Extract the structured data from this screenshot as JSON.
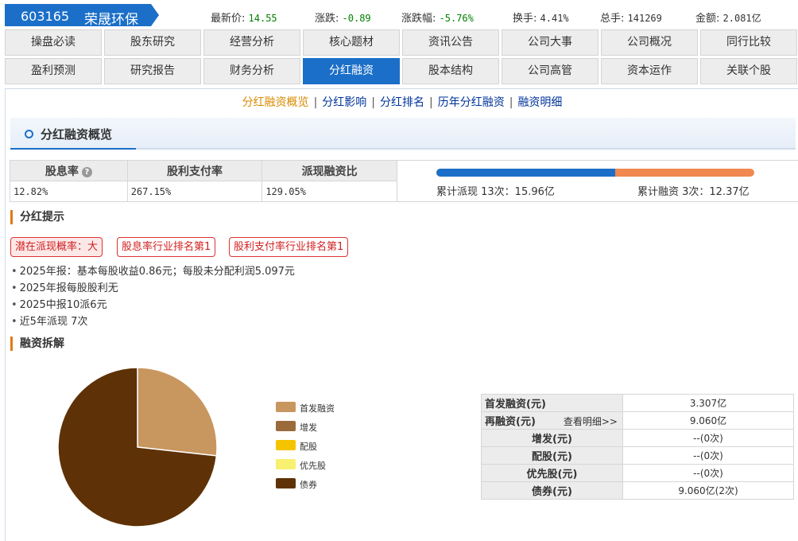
{
  "stock": {
    "code": "603165",
    "name": "荣晟环保"
  },
  "quotes": [
    {
      "label": "最新价:",
      "value": "14.55",
      "tone": "green"
    },
    {
      "label": "涨跌:",
      "value": "-0.89",
      "tone": "green"
    },
    {
      "label": "涨跌幅:",
      "value": "-5.76%",
      "tone": "green"
    },
    {
      "label": "换手:",
      "value": "4.41%",
      "tone": "plain"
    },
    {
      "label": "总手:",
      "value": "141269",
      "tone": "plain"
    },
    {
      "label": "金额:",
      "value": "2.081亿",
      "tone": "plain"
    }
  ],
  "nav": {
    "row1": [
      "操盘必读",
      "股东研究",
      "经营分析",
      "核心题材",
      "资讯公告",
      "公司大事",
      "公司概况",
      "同行比较"
    ],
    "row2": [
      "盈利预测",
      "研究报告",
      "财务分析",
      "分红融资",
      "股本结构",
      "公司高管",
      "资本运作",
      "关联个股"
    ],
    "active": "分红融资"
  },
  "subnav": {
    "links": [
      "分红融资概览",
      "分红影响",
      "分红排名",
      "历年分红融资",
      "融资明细"
    ],
    "current": "分红融资概览",
    "separator": "|"
  },
  "overview": {
    "title": "分红融资概览",
    "help_icon": "question-mark",
    "headers": [
      "股息率",
      "股利支付率",
      "派现融资比"
    ],
    "values": [
      "12.82%",
      "267.15%",
      "129.05%"
    ],
    "payout_ratio": 0.5633,
    "payout_text": "累计派现  13次：15.96亿",
    "financing_text": "累计融资  3次：12.37亿",
    "colors": {
      "payout": "#1b6fc8",
      "financing": "#f08850"
    }
  },
  "dividend_tips": {
    "title": "分红提示",
    "badges": [
      "潜在派现概率：大",
      "股息率行业排名第1",
      "股利支付率行业排名第1"
    ],
    "items": [
      "2025年报：基本每股收益0.86元；每股未分配利润5.097元",
      "2025年报每股股利无",
      "2025中报10派6元",
      "近5年派现 7次"
    ]
  },
  "financing": {
    "title": "融资拆解",
    "legend": [
      {
        "name": "首发融资",
        "color": "#c8965f"
      },
      {
        "name": "增发",
        "color": "#9b6a3b"
      },
      {
        "name": "配股",
        "color": "#f5c400"
      },
      {
        "name": "优先股",
        "color": "#f8f070"
      },
      {
        "name": "债券",
        "color": "#5e3206"
      }
    ],
    "pie_values": [
      3.307,
      0,
      0,
      0,
      9.06
    ],
    "table": [
      {
        "label": "首发融资(元)",
        "value": "3.307亿"
      },
      {
        "label": "再融资(元)",
        "value": "9.060亿",
        "link": "查看明细>>"
      },
      {
        "label": "增发(元)",
        "value": "--(0次)"
      },
      {
        "label": "配股(元)",
        "value": "--(0次)"
      },
      {
        "label": "优先股(元)",
        "value": "--(0次)"
      },
      {
        "label": "债券(元)",
        "value": "9.060亿(2次)"
      }
    ]
  }
}
